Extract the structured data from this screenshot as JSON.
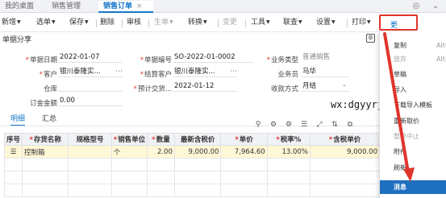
{
  "tabs": [
    {
      "label": "我的桌面",
      "active": false
    },
    {
      "label": "销售管理",
      "active": false
    },
    {
      "label": "销售订单",
      "active": true
    }
  ],
  "tab_close": "×",
  "toolbar": {
    "new": "新增",
    "select": "选单",
    "save": "保存",
    "delete": "删除",
    "audit": "审核",
    "generate": "生单",
    "convert": "转换",
    "change": "变更",
    "tools": "工具",
    "linked": "联查",
    "settings": "设置",
    "print": "打印",
    "more": "更多"
  },
  "doc_share": "单据分享",
  "form": {
    "doc_date_label": "单据日期",
    "doc_date": "2022-01-07",
    "doc_no_label": "单据编号",
    "doc_no": "SO-2022-01-0002",
    "biz_type_label": "业务类型",
    "biz_type": "普通销售",
    "customer_label": "客户",
    "customer": "银川泰隆实...",
    "settle_customer_label": "结算客户",
    "settle_customer": "银川泰隆实...",
    "salesperson_label": "业务员",
    "salesperson": "马华",
    "warehouse_label": "仓库",
    "delivery_label": "预计交货...",
    "delivery": "2022-01-12",
    "collect_label": "收款方式",
    "collect": "月结",
    "deposit_label": "订金金额",
    "deposit": "0.00"
  },
  "detail_tabs": {
    "detail": "明细",
    "summary": "汇总"
  },
  "grid": {
    "headers": [
      "序号",
      "存货名称",
      "规格型号",
      "销售单位",
      "数量",
      "最新含税价",
      "单价",
      "税率%",
      "含税单价"
    ],
    "row": {
      "no": "",
      "name": "控制箱",
      "spec": "",
      "unit": "个",
      "qty": "2.00",
      "latest": "9,000.00",
      "price": "7,964.60",
      "tax": "13.00%",
      "taxprice": "9,000.00"
    }
  },
  "menu": [
    {
      "label": "复制",
      "shortcut": "Alt-",
      "disabled": false
    },
    {
      "label": "放弃",
      "shortcut": "Alt-",
      "disabled": true
    },
    {
      "label": "草稿",
      "shortcut": "",
      "disabled": false
    },
    {
      "label": "导入",
      "shortcut": "",
      "disabled": false
    },
    {
      "label": "下载导入模板",
      "shortcut": "",
      "disabled": false
    },
    {
      "label": "重新取价",
      "shortcut": "",
      "disabled": false
    },
    {
      "label": "整单中止",
      "shortcut": "",
      "disabled": true
    },
    {
      "label": "附件",
      "shortcut": "",
      "disabled": false
    },
    {
      "label": "刷新",
      "shortcut": "",
      "disabled": false
    },
    {
      "label": "消息",
      "shortcut": "",
      "disabled": false,
      "highlighted": true
    }
  ],
  "watermark": "wx:dgyyrj",
  "colors": {
    "accent": "#1677c9",
    "highlight_border": "#e0352b",
    "arrow": "#e0352b",
    "selected_row": "#fff7d6",
    "menu_highlight": "#1f6fc0"
  }
}
